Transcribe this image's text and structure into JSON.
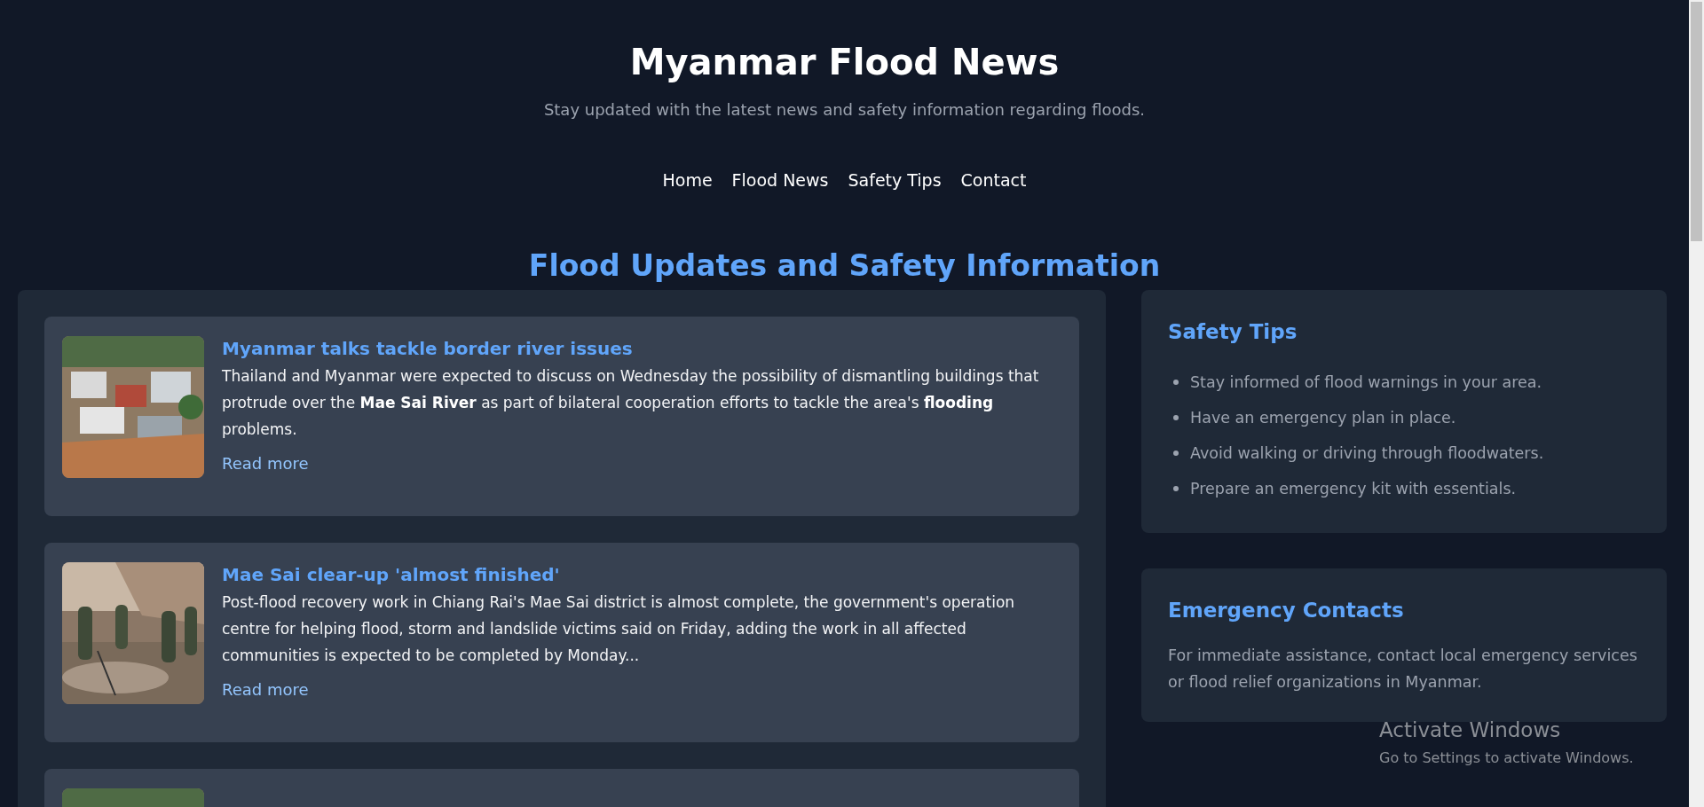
{
  "header": {
    "title": "Myanmar Flood News",
    "subtitle": "Stay updated with the latest news and safety information regarding floods."
  },
  "nav": [
    {
      "label": "Home"
    },
    {
      "label": "Flood News"
    },
    {
      "label": "Safety Tips"
    },
    {
      "label": "Contact"
    }
  ],
  "section_title": "Flood Updates and Safety Information",
  "articles": [
    {
      "image": {
        "kind": "picture"
      },
      "title": "Myanmar talks tackle border river issues",
      "summary": "Thailand and Myanmar were expected to discuss on Wednesday the possibility of dismantling buildings that protrude over the **Mae Sai River** as part of bilateral cooperation efforts to tackle the area's **flooding** problems.",
      "link": "Read more"
    },
    {
      "image": {
        "kind": "picture"
      },
      "title": "Mae Sai clear-up 'almost finished'",
      "summary": "Post-flood recovery work in Chiang Rai's Mae Sai district is almost complete, the government's operation centre for helping flood, storm and landslide victims said on Friday, adding the work in all affected communities is expected to be completed by Monday...",
      "link": "Read more"
    },
    {
      "image": {
        "kind": "picture"
      }
    }
  ],
  "sidebar": {
    "safety_tips": {
      "title": "Safety Tips",
      "items": [
        "Stay informed of flood warnings in your area.",
        "Have an emergency plan in place.",
        "Avoid walking or driving through floodwaters.",
        "Prepare an emergency kit with essentials."
      ]
    },
    "emergency_contacts": {
      "title": "Emergency Contacts",
      "text": "For immediate assistance, contact local emergency services or flood relief organizations in Myanmar."
    }
  },
  "os_notice": {
    "title": "Activate Windows",
    "text": "Go to Settings to activate Windows."
  }
}
